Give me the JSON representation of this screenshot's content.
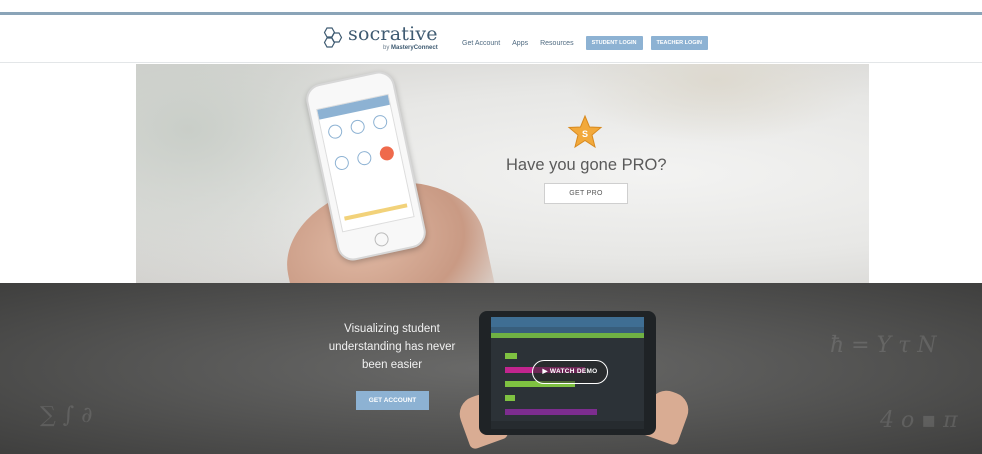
{
  "header": {
    "logo": {
      "word": "socrative",
      "by": "by",
      "brand": "MasteryConnect"
    },
    "nav": [
      {
        "label": "Get Account"
      },
      {
        "label": "Apps"
      },
      {
        "label": "Resources"
      }
    ],
    "student_login": "STUDENT LOGIN",
    "teacher_login": "TEACHER LOGIN"
  },
  "hero": {
    "title": "Have you gone PRO?",
    "button": "GET PRO",
    "star_letter": "S"
  },
  "band": {
    "title": "Visualizing student understanding has never been easier",
    "button": "GET ACCOUNT",
    "demo_button": "▶ WATCH DEMO"
  },
  "colors": {
    "accent": "#8db2d3",
    "brand_text": "#3f5b72",
    "star": "#f2a93b",
    "magenta": "#c2258e",
    "green": "#7fc241",
    "purple": "#7d2d8f"
  }
}
